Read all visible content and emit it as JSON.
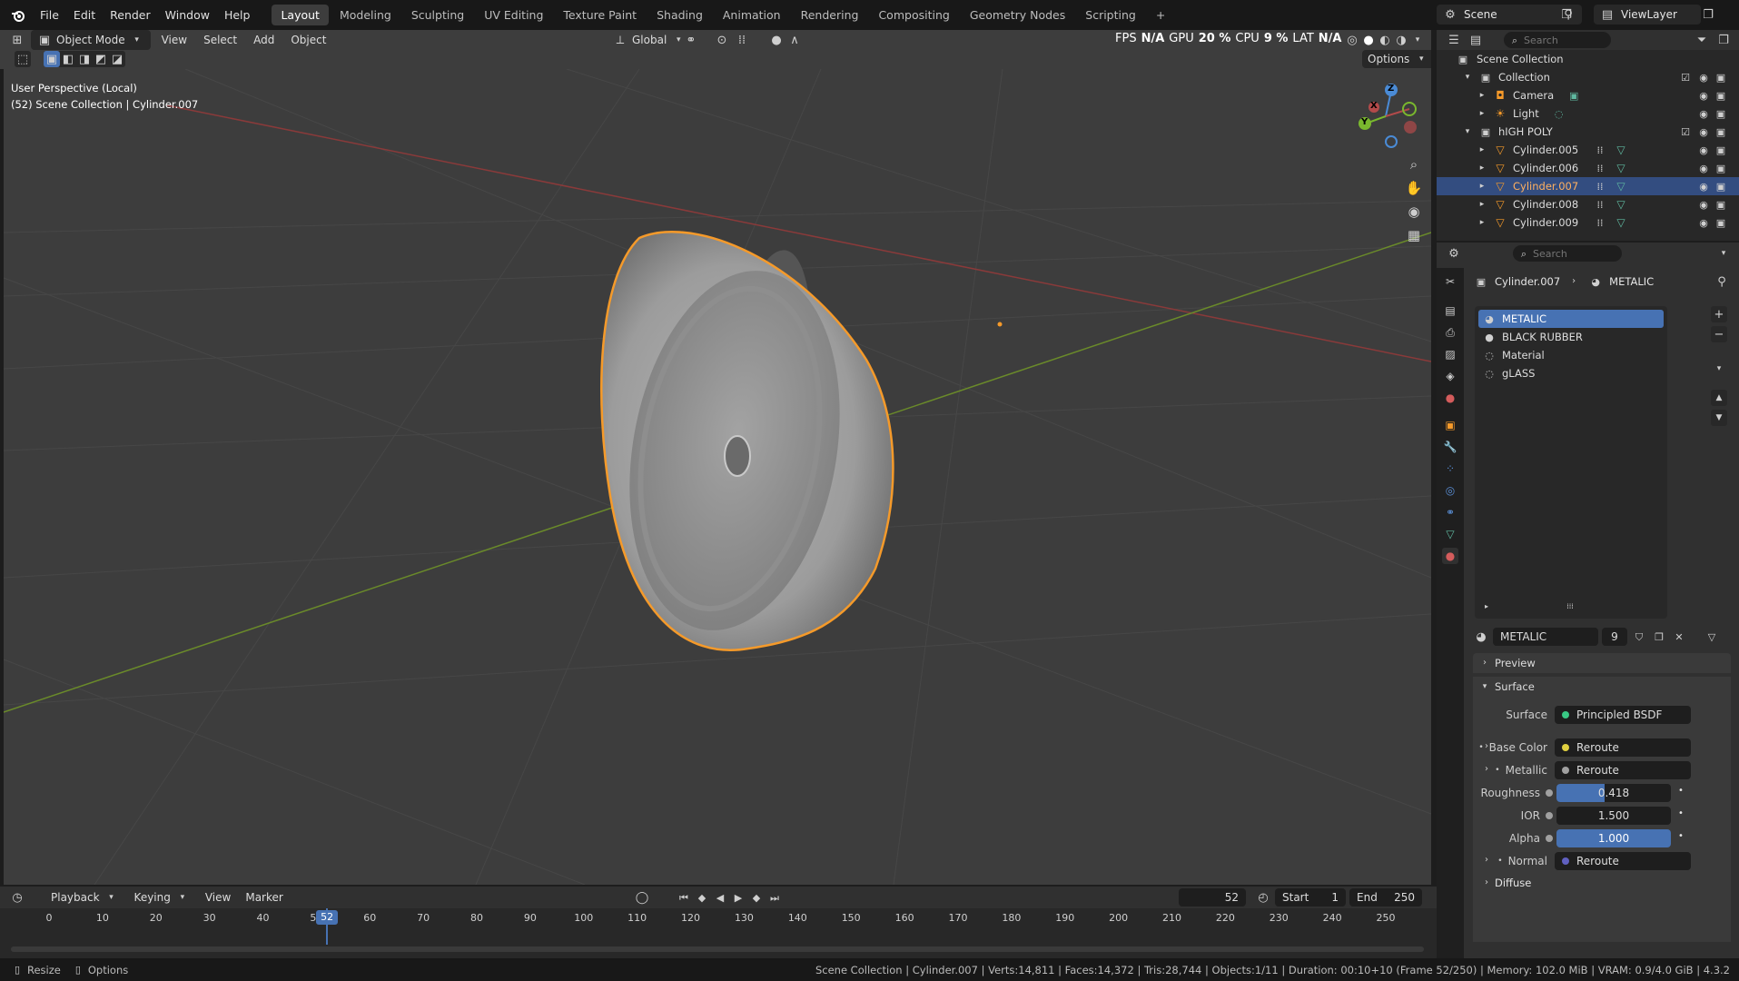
{
  "topbar": {
    "menus": [
      "File",
      "Edit",
      "Render",
      "Window",
      "Help"
    ],
    "workspaces": [
      "Layout",
      "Modeling",
      "Sculpting",
      "UV Editing",
      "Texture Paint",
      "Shading",
      "Animation",
      "Rendering",
      "Compositing",
      "Geometry Nodes",
      "Scripting"
    ],
    "active_workspace": "Layout",
    "add_tab": "+",
    "scene": "Scene",
    "view_layer": "ViewLayer"
  },
  "viewport_header": {
    "mode": "Object Mode",
    "menus": [
      "View",
      "Select",
      "Add",
      "Object"
    ],
    "orientation": "Global",
    "options": "Options",
    "overlay_stats": {
      "fps_label": "FPS",
      "fps": "N/A",
      "gpu_label": "GPU",
      "gpu": "20 %",
      "cpu_label": "CPU",
      "cpu": "9 %",
      "lat_label": "LAT",
      "lat": "N/A"
    }
  },
  "viewport": {
    "perspective": "User Perspective (Local)",
    "context": "(52) Scene Collection | Cylinder.007",
    "gizmo": {
      "z": "Z",
      "y": "Y",
      "x": "X"
    },
    "colors": {
      "background": "#3d3d3d",
      "selection": "#f59a2a",
      "x_axis": "#8a3a3a",
      "y_axis": "#6a8a2a"
    }
  },
  "outliner": {
    "search_placeholder": "Search",
    "root": "Scene Collection",
    "items": [
      {
        "name": "Collection",
        "type": "collection"
      },
      {
        "name": "Camera",
        "type": "camera"
      },
      {
        "name": "Light",
        "type": "light"
      },
      {
        "name": "hIGH POLY",
        "type": "collection"
      },
      {
        "name": "Cylinder.005",
        "type": "mesh"
      },
      {
        "name": "Cylinder.006",
        "type": "mesh"
      },
      {
        "name": "Cylinder.007",
        "type": "mesh",
        "selected": true
      },
      {
        "name": "Cylinder.008",
        "type": "mesh"
      },
      {
        "name": "Cylinder.009",
        "type": "mesh"
      }
    ]
  },
  "properties": {
    "search_placeholder": "Search",
    "breadcrumb_object": "Cylinder.007",
    "breadcrumb_material": "METALIC",
    "material_slots": [
      "METALIC",
      "BLACK RUBBER",
      "Material",
      "gLASS"
    ],
    "active_material": "METALIC",
    "user_count": "9",
    "panels": {
      "preview": "Preview",
      "surface": "Surface",
      "diffuse": "Diffuse"
    },
    "surface_label": "Surface",
    "surface_value": "Principled BSDF",
    "inputs": [
      {
        "label": "Base Color",
        "value": "Reroute",
        "dot": "#e0d040"
      },
      {
        "label": "Metallic",
        "value": "Reroute",
        "dot": "#a0a0a0"
      }
    ],
    "sliders": [
      {
        "label": "Roughness",
        "value": "0.418",
        "fill": 0.418
      },
      {
        "label": "IOR",
        "value": "1.500",
        "fill": 0
      },
      {
        "label": "Alpha",
        "value": "1.000",
        "fill": 1.0
      }
    ],
    "normal": {
      "label": "Normal",
      "value": "Reroute",
      "dot": "#6060c0"
    }
  },
  "timeline": {
    "menus": [
      "Playback",
      "Keying",
      "View",
      "Marker"
    ],
    "current_frame": "52",
    "start_label": "Start",
    "start": "1",
    "end_label": "End",
    "end": "250",
    "ticks": [
      "0",
      "10",
      "20",
      "30",
      "40",
      "50",
      "60",
      "70",
      "80",
      "90",
      "100",
      "110",
      "120",
      "130",
      "140",
      "150",
      "160",
      "170",
      "180",
      "190",
      "200",
      "210",
      "220",
      "230",
      "240",
      "250"
    ],
    "playhead": 52,
    "frame_range": [
      0,
      250
    ]
  },
  "statusbar": {
    "left_items": [
      "Resize",
      "Options"
    ],
    "stats": "Scene Collection | Cylinder.007 | Verts:14,811 | Faces:14,372 | Tris:28,744 | Objects:1/11 | Duration: 00:10+10 (Frame 52/250) | Memory: 102.0 MiB | VRAM: 0.9/4.0 GiB | 4.3.2"
  }
}
